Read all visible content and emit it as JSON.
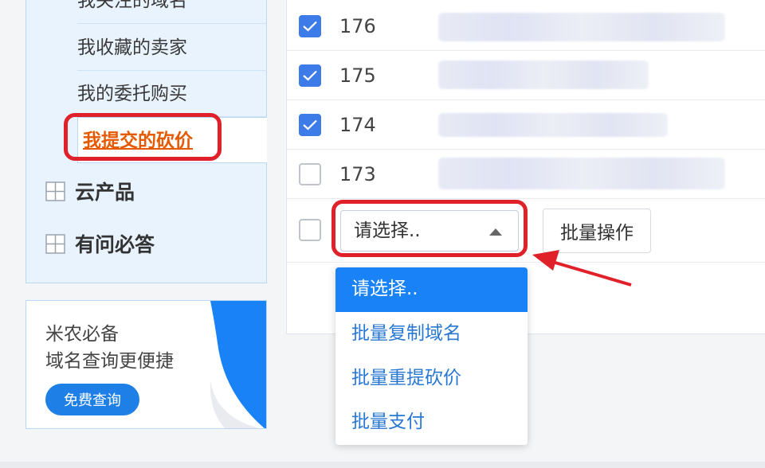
{
  "sidebar": {
    "sub_items": [
      {
        "label": "我关注的域名"
      },
      {
        "label": "我收藏的卖家"
      },
      {
        "label": "我的委托购买"
      },
      {
        "label": "我提交的砍价"
      }
    ],
    "groups": [
      {
        "label": "云产品",
        "icon": "grid-icon"
      },
      {
        "label": "有问必答",
        "icon": "grid-icon"
      }
    ]
  },
  "ad": {
    "line1": "米农必备",
    "line2": "域名查询更便捷",
    "button": "免费查询",
    "accent": "#1e7fe6"
  },
  "table": {
    "rows": [
      {
        "id": "176",
        "checked": true
      },
      {
        "id": "175",
        "checked": true
      },
      {
        "id": "174",
        "checked": true
      },
      {
        "id": "173",
        "checked": false
      }
    ]
  },
  "bulk": {
    "select_value": "请选择..",
    "button_label": "批量操作",
    "options": [
      "请选择..",
      "批量复制域名",
      "批量重提砍价",
      "批量支付"
    ]
  },
  "colors": {
    "highlight_red": "#e0212a",
    "active_link": "#e55a00",
    "checkbox_blue": "#3d7be8",
    "option_selected": "#1a82f7"
  }
}
